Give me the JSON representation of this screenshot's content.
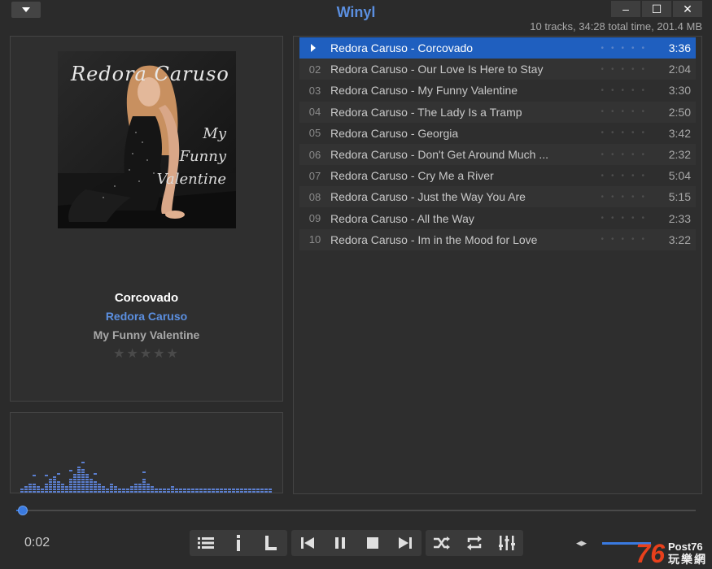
{
  "app": {
    "title": "Winyl"
  },
  "window_controls": {
    "minimize": "–",
    "maximize": "☐",
    "close": "✕"
  },
  "stats": "10 tracks, 34:28 total time, 201.4 MB",
  "cover": {
    "artist_text": "Redora Caruso",
    "album_text": "My\nFunny\nValentine"
  },
  "now_playing": {
    "title": "Corcovado",
    "artist": "Redora Caruso",
    "album": "My Funny Valentine",
    "rating": 0,
    "stars": "★★★★★"
  },
  "playlist": [
    {
      "num": "",
      "name": "Redora Caruso - Corcovado",
      "rating": "•••••",
      "duration": "3:36",
      "active": true
    },
    {
      "num": "02",
      "name": "Redora Caruso - Our Love Is Here to Stay",
      "rating": "•••••",
      "duration": "2:04"
    },
    {
      "num": "03",
      "name": "Redora Caruso - My Funny Valentine",
      "rating": "•••••",
      "duration": "3:30"
    },
    {
      "num": "04",
      "name": "Redora Caruso - The Lady Is a Tramp",
      "rating": "•••••",
      "duration": "2:50"
    },
    {
      "num": "05",
      "name": "Redora Caruso - Georgia",
      "rating": "•••••",
      "duration": "3:42"
    },
    {
      "num": "06",
      "name": "Redora Caruso - Don't Get Around Much ...",
      "rating": "•••••",
      "duration": "2:32"
    },
    {
      "num": "07",
      "name": "Redora Caruso - Cry Me a River",
      "rating": "•••••",
      "duration": "5:04"
    },
    {
      "num": "08",
      "name": "Redora Caruso - Just the Way You Are",
      "rating": "•••••",
      "duration": "5:15"
    },
    {
      "num": "09",
      "name": "Redora Caruso - All the Way",
      "rating": "•••••",
      "duration": "2:33"
    },
    {
      "num": "10",
      "name": "Redora Caruso - Im in the Mood for Love",
      "rating": "•••••",
      "duration": "3:22"
    }
  ],
  "player": {
    "elapsed": "0:02",
    "progress_fraction": 0.01,
    "volume_fraction": 0.85
  },
  "controls": {
    "playlist_icon": "list-icon",
    "info_icon": "info-icon",
    "lyrics_icon": "lyrics-icon",
    "prev_icon": "previous-icon",
    "pause_icon": "pause-icon",
    "stop_icon": "stop-icon",
    "next_icon": "next-icon",
    "shuffle_icon": "shuffle-icon",
    "repeat_icon": "repeat-icon",
    "equalizer_icon": "equalizer-icon",
    "volume_icon": "volume-icon"
  },
  "watermark": {
    "number": "76",
    "top": "Post76",
    "bottom": "玩樂網"
  },
  "colors": {
    "accent": "#5b8fe0",
    "selected": "#1f5fbf",
    "background": "#2b2b2b"
  }
}
